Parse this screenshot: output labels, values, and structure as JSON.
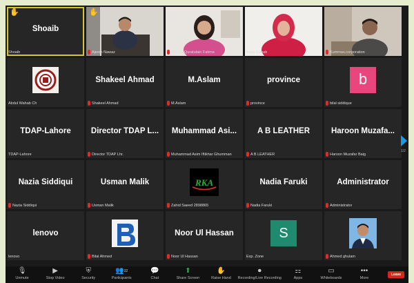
{
  "participants": [
    {
      "big_name": "Shoaib",
      "label": "Shoaib",
      "hand": true,
      "active": true,
      "muted": false
    },
    {
      "big_name": "",
      "label": "Ajeem Nawaz",
      "hand": true,
      "muted": true
    },
    {
      "big_name": "",
      "label": "TIC LA-Quratulain Fatima",
      "muted": true
    },
    {
      "big_name": "",
      "label": "faiqa Zainab",
      "muted": true
    },
    {
      "big_name": "",
      "label": "Kummas.corporation",
      "muted": true
    },
    {
      "big_name": "",
      "label": "Abdul Wahab Ch",
      "muted": false
    },
    {
      "big_name": "Shakeel Ahmad",
      "label": "Shakeel Ahmad",
      "muted": true
    },
    {
      "big_name": "M.Aslam",
      "label": "M.Aslam",
      "muted": true
    },
    {
      "big_name": "province",
      "label": "province",
      "muted": true
    },
    {
      "big_name": "",
      "label": "bilal siddique",
      "muted": true,
      "avatar_letter": "b",
      "avatar_color": "#e8467c"
    },
    {
      "big_name": "TDAP-Lahore",
      "label": "TDAP-Lahore",
      "muted": false
    },
    {
      "big_name": "Director TDAP L...",
      "label": "Director TDAP Lhr.",
      "muted": true
    },
    {
      "big_name": "Muhammad Asi...",
      "label": "Muhammad Asim Iftikhar Ghumman",
      "muted": true
    },
    {
      "big_name": "A B LEATHER",
      "label": "A B LEATHER",
      "muted": true
    },
    {
      "big_name": "Haroon Muzafa...",
      "label": "Haroon Muzafar Baig",
      "muted": true
    },
    {
      "big_name": "Nazia Siddiqui",
      "label": "Nazia Siddiqui",
      "muted": true
    },
    {
      "big_name": "Usman Malik",
      "label": "Usman Malik",
      "muted": true
    },
    {
      "big_name": "",
      "label": "Zahid Saeed 2898865",
      "muted": true,
      "logo_text": "RKA"
    },
    {
      "big_name": "Nadia Faruki",
      "label": "Nadia Faruki",
      "muted": true
    },
    {
      "big_name": "Administrator",
      "label": "Administrator",
      "muted": true
    },
    {
      "big_name": "lenovo",
      "label": "lenovo",
      "muted": false
    },
    {
      "big_name": "",
      "label": "Bilal Ahmed",
      "muted": true
    },
    {
      "big_name": "Noor Ul Hassan",
      "label": "Noor Ul Hassan",
      "muted": true
    },
    {
      "big_name": "",
      "label": "Exp. Zone",
      "muted": false,
      "avatar_letter": "S",
      "avatar_color": "#1f8a6e"
    },
    {
      "big_name": "",
      "label": "Ahmed ghulam",
      "muted": true
    }
  ],
  "pagination": {
    "text": "1/2"
  },
  "toolbar": {
    "items": [
      {
        "label": "Unmute",
        "icon": "microphone-icon"
      },
      {
        "label": "Stop Video",
        "icon": "video-camera-icon"
      },
      {
        "label": "Security",
        "icon": "shield-icon"
      },
      {
        "label": "Participants",
        "icon": "participants-icon",
        "count": "32"
      },
      {
        "label": "Chat",
        "icon": "chat-icon"
      },
      {
        "label": "Share Screen",
        "icon": "share-screen-icon"
      },
      {
        "label": "Raise Hand",
        "icon": "hand-icon"
      },
      {
        "label": "Recording/Live Recording",
        "icon": "record-icon"
      },
      {
        "label": "Apps",
        "icon": "apps-icon"
      },
      {
        "label": "Whiteboards",
        "icon": "whiteboard-icon"
      },
      {
        "label": "More",
        "icon": "more-icon"
      }
    ],
    "leave_label": "Leave"
  },
  "colors": {
    "accent_green": "#2ea84a",
    "leave_red": "#d6271b",
    "mute_red": "#e02b2b",
    "active_border": "#d7c72a"
  }
}
